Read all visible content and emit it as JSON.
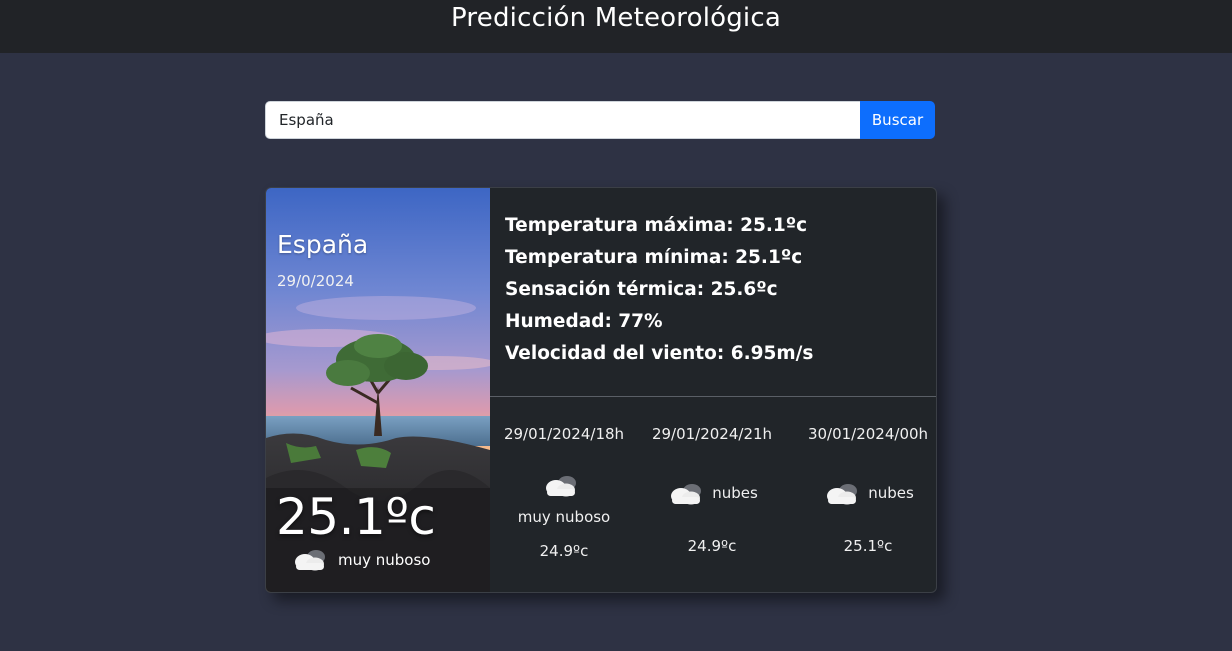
{
  "header": {
    "title": "Predicción Meteorológica"
  },
  "search": {
    "value": "España",
    "button_label": "Buscar"
  },
  "current": {
    "city": "España",
    "date": "29/0/2024",
    "temperature": "25.1ºc",
    "description": "muy nuboso",
    "icon": "cloud-icon"
  },
  "details": {
    "max_temp": "Temperatura máxima: 25.1ºc",
    "min_temp": "Temperatura mínima: 25.1ºc",
    "feels_like": "Sensación térmica: 25.6ºc",
    "humidity": "Humedad: 77%",
    "wind": "Velocidad del viento: 6.95m/s"
  },
  "forecast": [
    {
      "datetime": "29/01/2024/18h",
      "description": "muy nuboso",
      "temperature": "24.9ºc",
      "icon": "cloud-icon"
    },
    {
      "datetime": "29/01/2024/21h",
      "description": "nubes",
      "temperature": "24.9ºc",
      "icon": "cloud-icon"
    },
    {
      "datetime": "30/01/2024/00h",
      "description": "nubes",
      "temperature": "25.1ºc",
      "icon": "cloud-icon"
    }
  ]
}
